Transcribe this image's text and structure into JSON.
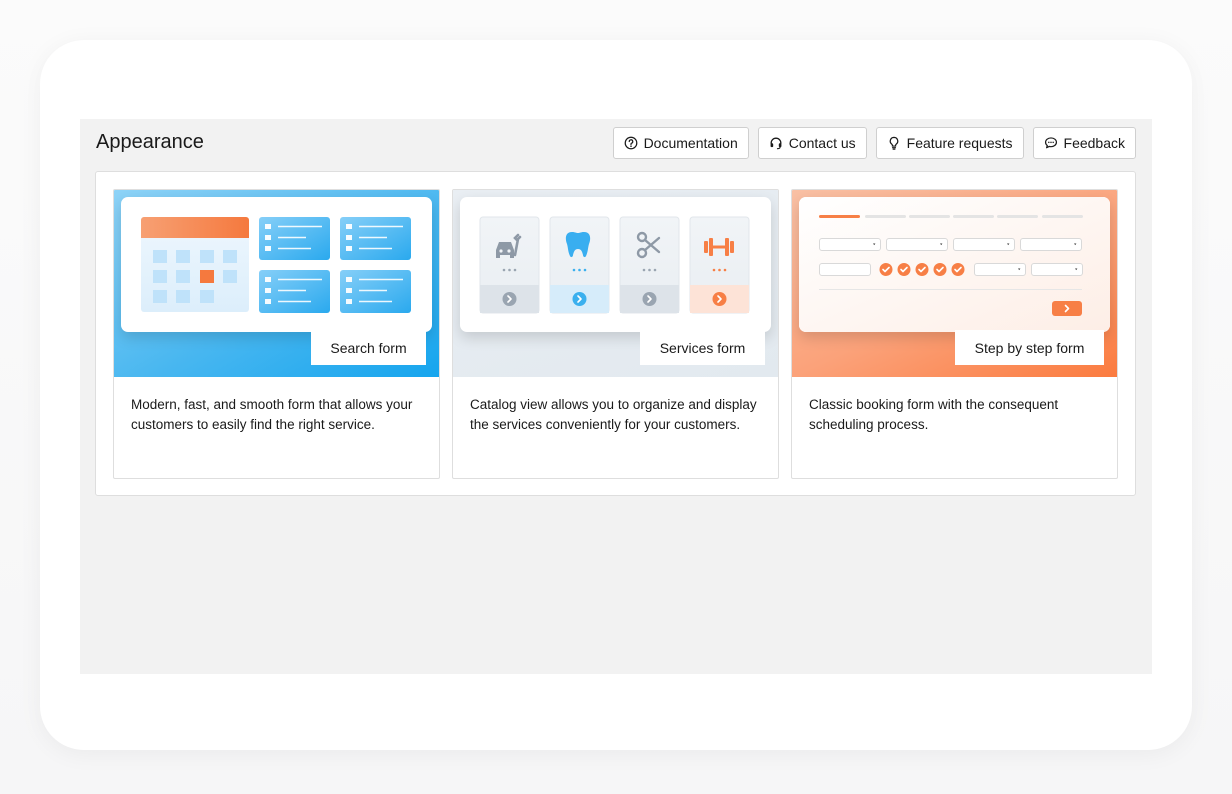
{
  "page": {
    "title": "Appearance"
  },
  "header_buttons": [
    {
      "label": "Documentation",
      "icon": "question-circle-icon"
    },
    {
      "label": "Contact us",
      "icon": "headset-icon"
    },
    {
      "label": "Feature requests",
      "icon": "lightbulb-icon"
    },
    {
      "label": "Feedback",
      "icon": "chat-bubble-icon"
    }
  ],
  "cards": [
    {
      "label": "Search form",
      "description": "Modern, fast, and smooth form that allows your customers to easily find the right service.",
      "accent": "#1aa6ee"
    },
    {
      "label": "Services form",
      "description": "Catalog view allows you to organize and display the services conveniently for your customers.",
      "accent": "#9aa5b1"
    },
    {
      "label": "Step by step form",
      "description": "Classic booking form with the consequent scheduling process.",
      "accent": "#fb7b3f"
    }
  ],
  "colors": {
    "orange": "#f77f46",
    "blue": "#3bb0ee",
    "gray": "#9aa5b1"
  }
}
